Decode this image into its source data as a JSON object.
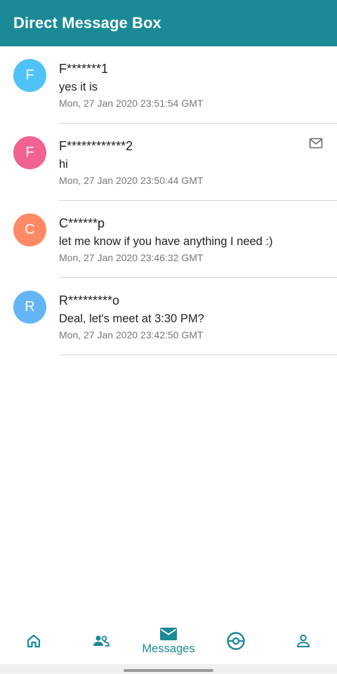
{
  "header": {
    "title": "Direct Message Box"
  },
  "conversations": [
    {
      "initial": "F",
      "avatar_color": "#4fc3f7",
      "sender": "F*******1",
      "preview": "yes it is",
      "timestamp": "Mon, 27 Jan 2020 23:51:54 GMT",
      "unread": false
    },
    {
      "initial": "F",
      "avatar_color": "#f06292",
      "sender": "F************2",
      "preview": "hi",
      "timestamp": "Mon, 27 Jan 2020 23:50:44 GMT",
      "unread": true,
      "unread_icon": "mail-icon"
    },
    {
      "initial": "C",
      "avatar_color": "#ff8a65",
      "sender": "C******p",
      "preview": "let me know if you have anything I need :)",
      "timestamp": "Mon, 27 Jan 2020 23:46:32 GMT",
      "unread": false
    },
    {
      "initial": "R",
      "avatar_color": "#64b5f6",
      "sender": "R*********o",
      "preview": "Deal, let's meet at 3:30 PM?",
      "timestamp": "Mon, 27 Jan 2020 23:42:50 GMT",
      "unread": false
    }
  ],
  "bottom_nav": {
    "accent_color": "#1a8a96",
    "items": [
      {
        "icon": "home-icon",
        "label": ""
      },
      {
        "icon": "people-icon",
        "label": ""
      },
      {
        "icon": "mail-icon",
        "label": "Messages",
        "selected": true
      },
      {
        "icon": "pokeball-icon",
        "label": ""
      },
      {
        "icon": "person-icon",
        "label": ""
      }
    ]
  },
  "theme": {
    "header_bg": "#1a8a96"
  }
}
